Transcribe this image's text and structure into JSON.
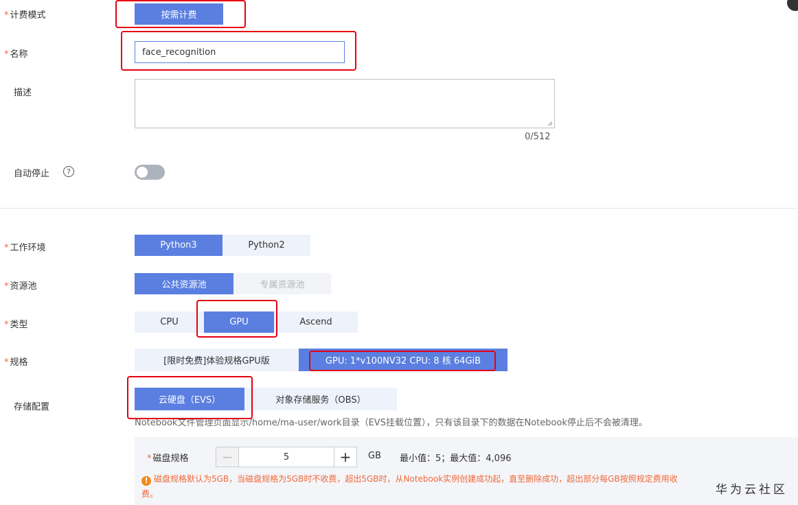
{
  "billing": {
    "label": "计费模式",
    "options": [
      "按需计费"
    ]
  },
  "name": {
    "label": "名称",
    "value": "face_recognition"
  },
  "description": {
    "label": "描述",
    "counter": "0/512"
  },
  "auto_stop": {
    "label": "自动停止",
    "help": "?",
    "enabled": false
  },
  "work_env": {
    "label": "工作环境",
    "options": [
      "Python3",
      "Python2"
    ],
    "selected": "Python3"
  },
  "resource_pool": {
    "label": "资源池",
    "options": [
      "公共资源池",
      "专属资源池"
    ],
    "selected": "公共资源池"
  },
  "type": {
    "label": "类型",
    "options": [
      "CPU",
      "GPU",
      "Ascend"
    ],
    "selected": "GPU"
  },
  "spec": {
    "label": "规格",
    "options": [
      "[限时免费]体验规格GPU版",
      "GPU: 1*v100NV32 CPU: 8 核 64GiB"
    ],
    "selected": "GPU: 1*v100NV32 CPU: 8 核 64GiB"
  },
  "storage": {
    "label": "存储配置",
    "options": [
      "云硬盘（EVS）",
      "对象存储服务（OBS）"
    ],
    "selected": "云硬盘（EVS）",
    "hint": "Notebook文件管理页面显示/home/ma-user/work目录（EVS挂载位置），只有该目录下的数据在Notebook停止后不会被清理。"
  },
  "disk": {
    "label": "磁盘规格",
    "value": "5",
    "unit": "GB",
    "range": "最小值：5；最大值：4,096",
    "warning_line1": "磁盘规格默认为5GB，当磁盘规格为5GB时不收费，超出5GB时，从Notebook实例创建成功起，直至删除成功，超出部分每GB按照规定费用收",
    "warning_line2": "费。"
  },
  "watermark": "华为云社区",
  "required_mark": "*",
  "colors": {
    "accent": "#5b7fe0",
    "annotation": "#e60012",
    "warning": "#f0693a"
  }
}
